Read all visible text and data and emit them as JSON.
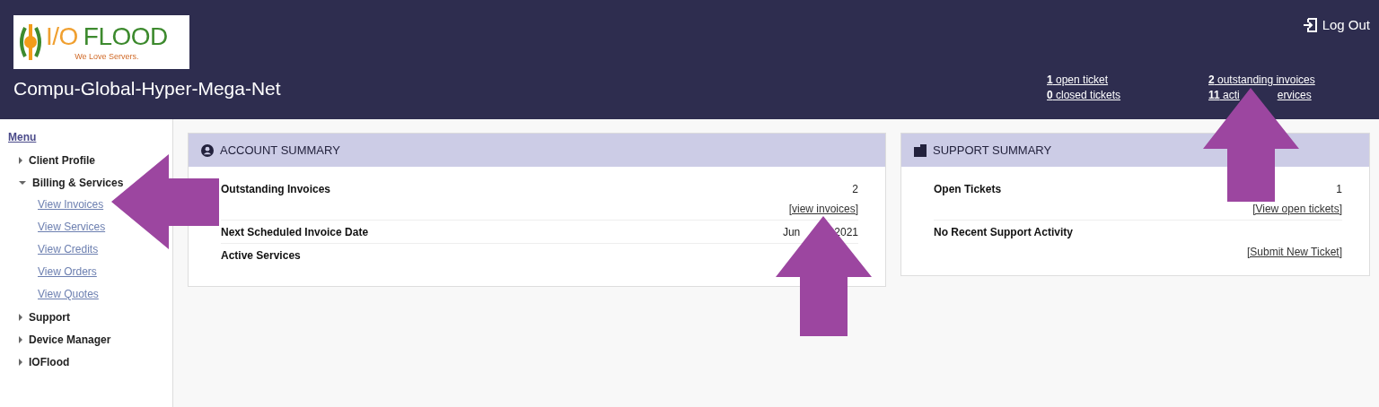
{
  "header": {
    "logo": {
      "name_left": "I/O",
      "name_right": "FLOOD",
      "tagline": "We Love Servers."
    },
    "company": "Compu-Global-Hyper-Mega-Net",
    "logout": "Log Out",
    "stats": [
      [
        {
          "parts": [
            "**1** open ticket"
          ]
        },
        {
          "parts": [
            "**0** closed tickets"
          ]
        }
      ],
      [
        {
          "parts": [
            "**2** outstanding invoices"
          ]
        },
        {
          "parts": [
            "**11** acti",
            "ervices"
          ]
        }
      ]
    ]
  },
  "sidebar": {
    "title": "Menu",
    "items": [
      {
        "label": "Client Profile",
        "expanded": false
      },
      {
        "label": "Billing & Services",
        "expanded": true,
        "children": [
          {
            "label": "View Invoices"
          },
          {
            "label": "View Services"
          },
          {
            "label": "View Credits"
          },
          {
            "label": "View Orders"
          },
          {
            "label": "View Quotes"
          }
        ]
      },
      {
        "label": "Support",
        "expanded": false
      },
      {
        "label": "Device Manager",
        "expanded": false
      },
      {
        "label": "IOFlood",
        "expanded": false
      }
    ]
  },
  "panels": [
    {
      "title": "ACCOUNT SUMMARY",
      "rows": [
        {
          "label": "Outstanding Invoices",
          "value": [
            "2"
          ],
          "link": "[view invoices]"
        },
        {
          "label": "Next Scheduled Invoice Date",
          "value": [
            "Jun",
            "2021"
          ]
        },
        {
          "label": "Active Services"
        }
      ]
    },
    {
      "title": "SUPPORT SUMMARY",
      "rows": [
        {
          "label": "Open Tickets",
          "value": [
            "1"
          ],
          "link": "[View open tickets]"
        },
        {
          "label": "No Recent Support Activity",
          "link": "[Submit New Ticket]"
        }
      ]
    }
  ],
  "annotations": [
    {
      "kind": "leftarrow"
    },
    {
      "kind": "uparrow"
    },
    {
      "kind": "uparrow"
    }
  ]
}
